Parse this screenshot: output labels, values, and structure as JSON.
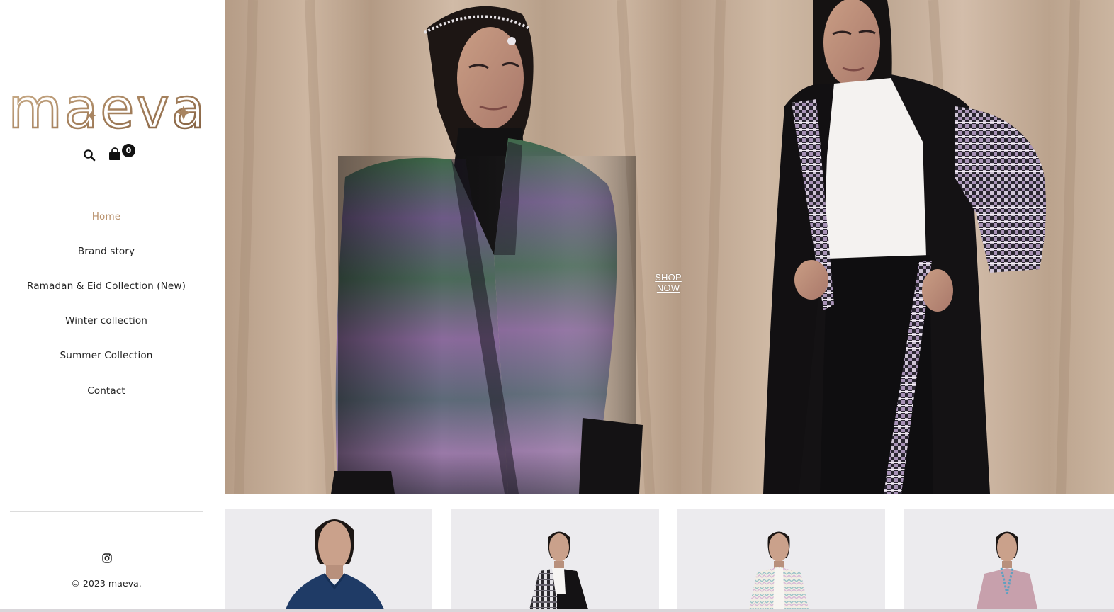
{
  "brand": {
    "logo_text": "maeva"
  },
  "header_icons": {
    "search_icon": "search-icon",
    "cart_icon": "shopping-bag-icon",
    "cart_count": "0"
  },
  "nav": {
    "items": [
      {
        "label": "Home",
        "active": true
      },
      {
        "label": "Brand story",
        "active": false
      },
      {
        "label": "Ramadan & Eid Collection (New)",
        "active": false
      },
      {
        "label": "Winter collection",
        "active": false
      },
      {
        "label": "Summer Collection",
        "active": false
      },
      {
        "label": "Contact",
        "active": false
      }
    ]
  },
  "footer": {
    "social_icon": "instagram-icon",
    "copyright": "© 2023 maeva."
  },
  "hero": {
    "cta_label": "SHOP NOW"
  },
  "products": [
    {
      "garment": "denim-shirt"
    },
    {
      "garment": "plaid-abaya"
    },
    {
      "garment": "zigzag-abaya"
    },
    {
      "garment": "pink-abaya"
    }
  ],
  "colors": {
    "accent_active_nav": "#b9916c",
    "logo_gradient": [
      "#c2a785",
      "#8c6745"
    ],
    "hero_backdrop": "#c4ab95"
  }
}
